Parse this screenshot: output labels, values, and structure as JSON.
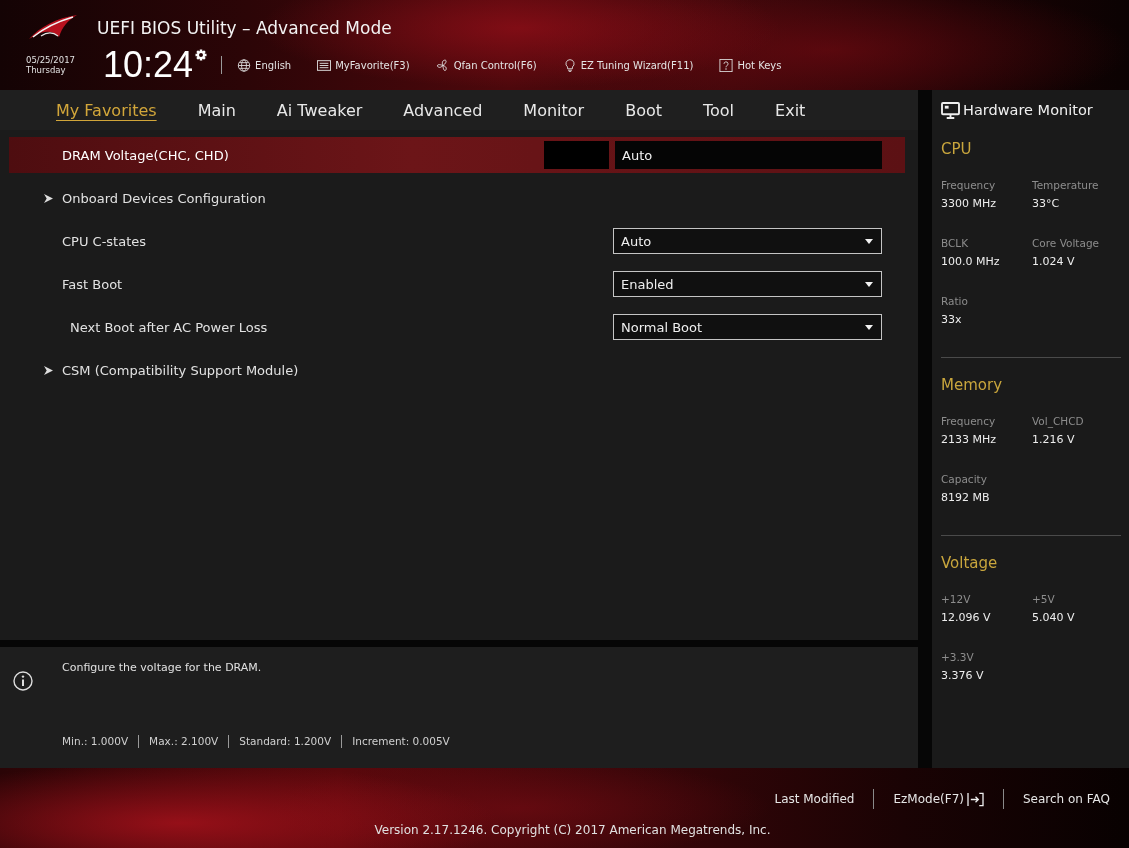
{
  "header": {
    "title": "UEFI BIOS Utility – Advanced Mode",
    "date": "05/25/2017",
    "day": "Thursday",
    "time": "10:24",
    "toolbar": [
      {
        "kind": "language",
        "label": "English"
      },
      {
        "kind": "favorites",
        "label": "MyFavorite(F3)"
      },
      {
        "kind": "fan",
        "label": "Qfan Control(F6)"
      },
      {
        "kind": "wizard",
        "label": "EZ Tuning Wizard(F11)"
      },
      {
        "kind": "hotkeys",
        "label": "Hot Keys"
      }
    ]
  },
  "tabs": [
    {
      "label": "My Favorites",
      "selected": true
    },
    {
      "label": "Main",
      "selected": false
    },
    {
      "label": "Ai Tweaker",
      "selected": false
    },
    {
      "label": "Advanced",
      "selected": false
    },
    {
      "label": "Monitor",
      "selected": false
    },
    {
      "label": "Boot",
      "selected": false
    },
    {
      "label": "Tool",
      "selected": false
    },
    {
      "label": "Exit",
      "selected": false
    }
  ],
  "settings": [
    {
      "kind": "input",
      "label": "DRAM Voltage(CHC, CHD)",
      "value": "Auto",
      "selected": true
    },
    {
      "kind": "submenu",
      "label": "Onboard Devices Configuration",
      "selected": false
    },
    {
      "kind": "dropdown",
      "label": "CPU C-states",
      "value": "Auto",
      "selected": false
    },
    {
      "kind": "dropdown",
      "label": "Fast Boot",
      "value": "Enabled",
      "selected": false,
      "children": [
        {
          "kind": "dropdown",
          "label": "Next Boot after AC Power Loss",
          "value": "Normal Boot",
          "selected": false
        }
      ]
    },
    {
      "kind": "submenu",
      "label": "CSM (Compatibility Support Module)",
      "selected": false
    }
  ],
  "help": {
    "text": "Configure the voltage for the DRAM.",
    "limits": [
      "Min.: 1.000V",
      "Max.: 2.100V",
      "Standard: 1.200V",
      "Increment: 0.005V"
    ]
  },
  "hardware_monitor": {
    "title": "Hardware Monitor",
    "sections": [
      {
        "title": "CPU",
        "items": [
          {
            "label": "Frequency",
            "value": "3300 MHz"
          },
          {
            "label": "Temperature",
            "value": "33°C"
          },
          {
            "label": "BCLK",
            "value": "100.0 MHz"
          },
          {
            "label": "Core Voltage",
            "value": "1.024 V"
          },
          {
            "label": "Ratio",
            "value": "33x"
          }
        ]
      },
      {
        "title": "Memory",
        "items": [
          {
            "label": "Frequency",
            "value": "2133 MHz"
          },
          {
            "label": "Vol_CHCD",
            "value": "1.216 V"
          },
          {
            "label": "Capacity",
            "value": "8192 MB"
          }
        ]
      },
      {
        "title": "Voltage",
        "items": [
          {
            "label": "+12V",
            "value": "12.096 V"
          },
          {
            "label": "+5V",
            "value": "5.040 V"
          },
          {
            "label": "+3.3V",
            "value": "3.376 V"
          }
        ]
      }
    ]
  },
  "footer": {
    "actions": [
      {
        "kind": "link",
        "label": "Last Modified"
      },
      {
        "kind": "mode",
        "label": "EzMode(F7)"
      },
      {
        "kind": "link",
        "label": "Search on FAQ"
      }
    ],
    "version": "Version 2.17.1246. Copyright (C) 2017 American Megatrends, Inc."
  }
}
